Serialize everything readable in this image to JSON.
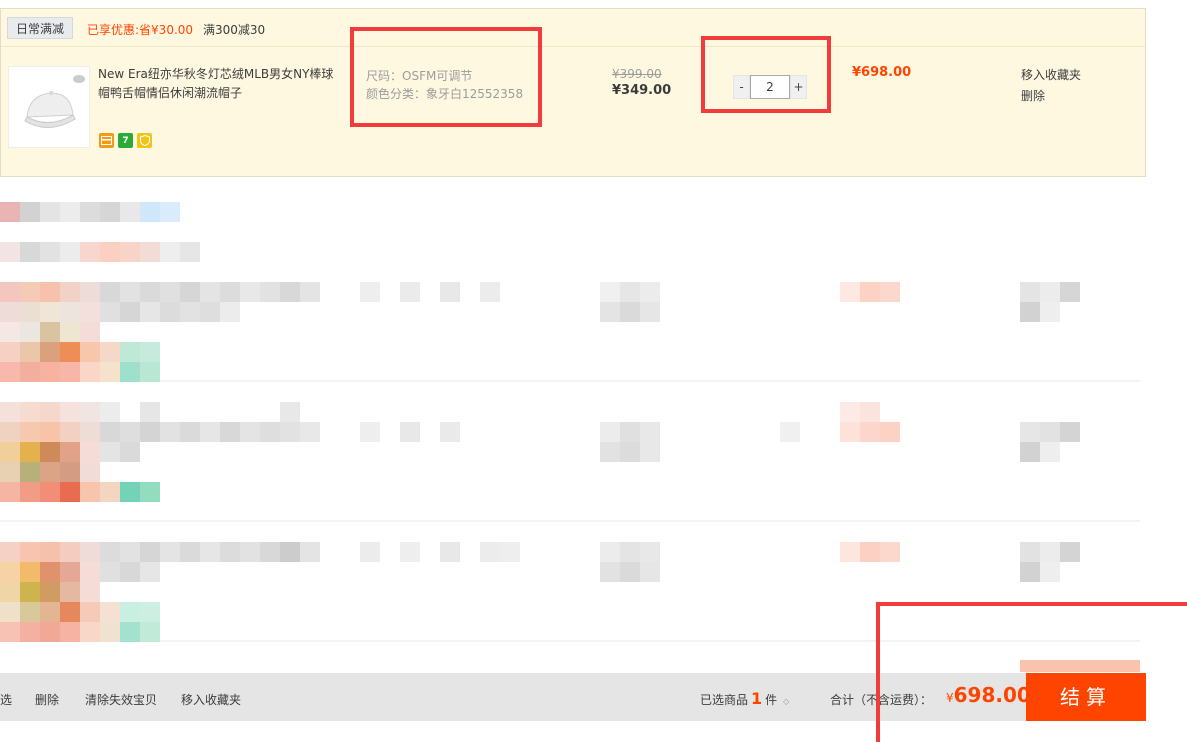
{
  "promo": {
    "tag": "日常满减",
    "saved": "已享优惠:省¥30.00",
    "rule": "满300减30"
  },
  "item": {
    "title": "New Era纽亦华秋冬灯芯绒MLB男女NY棒球帽鸭舌帽情侣休闲潮流帽子",
    "thumb_icon": "cap-icon",
    "sku_size": "尺码：OSFM可调节",
    "sku_color": "颜色分类：象牙白12552358",
    "price_original": "¥399.00",
    "price_current": "¥349.00",
    "qty_minus": "-",
    "qty_value": "2",
    "qty_plus": "+",
    "subtotal": "¥698.00",
    "op_favorite": "移入收藏夹",
    "op_delete": "删除",
    "service_icons": [
      "credit-card-icon",
      "seven-day-return-icon",
      "guarantee-icon"
    ]
  },
  "footer": {
    "delete": "删除",
    "clear_invalid": "清除失效宝贝",
    "move_favorite": "移入收藏夹",
    "selected_prefix": "已选商品",
    "selected_count": "1",
    "selected_suffix": "件",
    "total_label": "合计（不含运费）：",
    "total_currency": "¥",
    "total_value": "698.00",
    "checkout": "结算"
  },
  "colors": {
    "accent": "#ff4400",
    "highlight_row": "#fff8e1",
    "annotation_box": "#f23b3b"
  }
}
